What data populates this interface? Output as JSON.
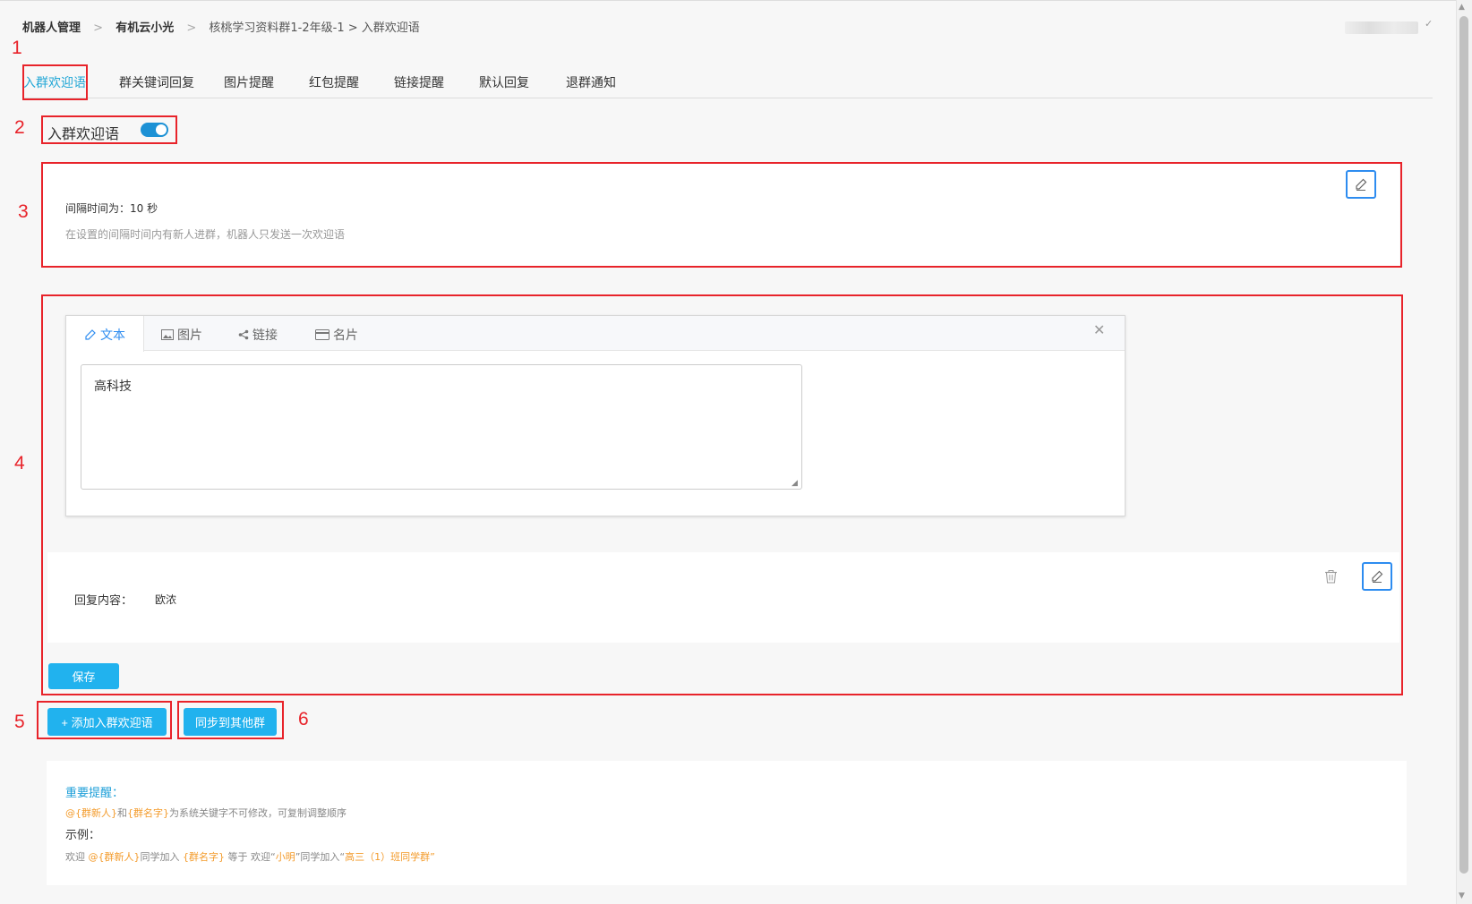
{
  "breadcrumb": {
    "item1": "机器人管理",
    "sep": ">",
    "item2": "有机云小光",
    "item3": "核桃学习资料群1-2年级-1 > 入群欢迎语"
  },
  "user_menu": {
    "caret": "✓"
  },
  "tabs": [
    "入群欢迎语",
    "群关键词回复",
    "图片提醒",
    "红包提醒",
    "链接提醒",
    "默认回复",
    "退群通知"
  ],
  "toggle": {
    "label": "入群欢迎语",
    "enabled": true
  },
  "interval": {
    "text": "间隔时间为：10 秒",
    "hint": "在设置的间隔时间内有新人进群，机器人只发送一次欢迎语"
  },
  "editor": {
    "tabs": [
      "文本",
      "图片",
      "链接",
      "名片"
    ],
    "active_tab": "文本",
    "content": "高科技"
  },
  "reply": {
    "label": "回复内容：",
    "value": "欧浓"
  },
  "buttons": {
    "save": "保存",
    "add": "+ 添加入群欢迎语",
    "sync": "同步到其他群"
  },
  "notice": {
    "title": "重要提醒：",
    "kw_newcomer": "@{群新人}",
    "kw_and": "和",
    "kw_group": "{群名字}",
    "rule_rest": "为系统关键字不可修改，可复制调整顺序",
    "example_title": "示例：",
    "ex_1": "欢迎",
    "ex_2": "同学加入",
    "ex_3": "等于 欢迎“",
    "ex_name": "小明",
    "ex_4": "”同学加入“",
    "ex_group": "高三（1）班同学群",
    "ex_5": "”"
  },
  "annotations": [
    "1",
    "2",
    "3",
    "4",
    "5",
    "6"
  ],
  "colors": {
    "accent": "#21b2ee",
    "annotation": "#e8232a",
    "toggle": "#1c91d5",
    "keyword": "#f39b2b"
  }
}
